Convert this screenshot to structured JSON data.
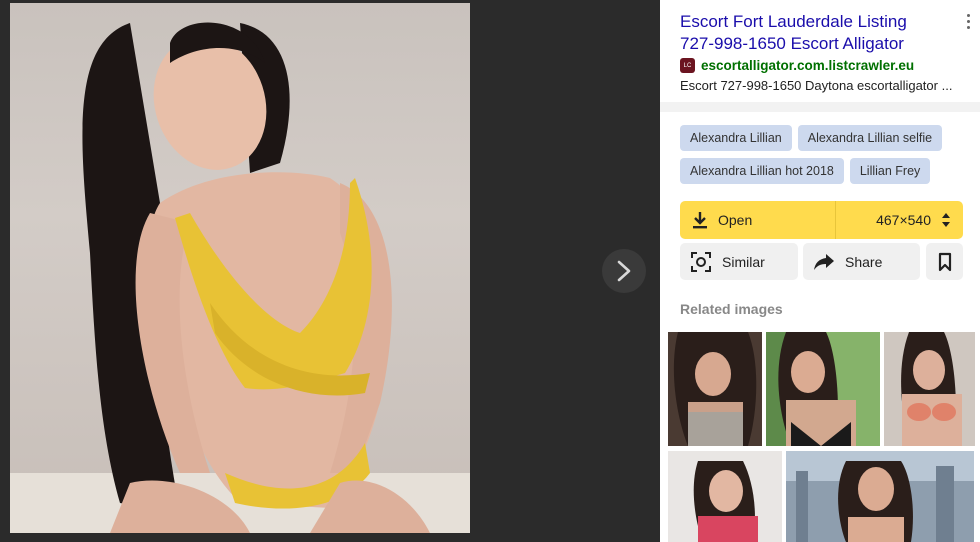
{
  "viewer": {
    "next_icon": "chevron-right-icon"
  },
  "result": {
    "title": "Escort Fort Lauderdale Listing 727-998-1650 Escort Alligator",
    "favicon_text": "LC",
    "site": "escortalligator.com.listcrawler.eu",
    "snippet": "Escort 727-998-1650 Daytona escortalligator ..."
  },
  "tags": [
    "Alexandra Lillian",
    "Alexandra Lillian selfie",
    "Alexandra Lillian hot 2018",
    "Lillian Frey"
  ],
  "actions": {
    "open_label": "Open",
    "size_label": "467×540",
    "similar_label": "Similar",
    "share_label": "Share"
  },
  "related": {
    "heading": "Related images"
  },
  "colors": {
    "viewer_bg": "#2b2b2b",
    "title_link": "#1a0dab",
    "site_green": "#007000",
    "tag_bg": "#cdd9ee",
    "open_yellow": "#ffdb4d"
  }
}
